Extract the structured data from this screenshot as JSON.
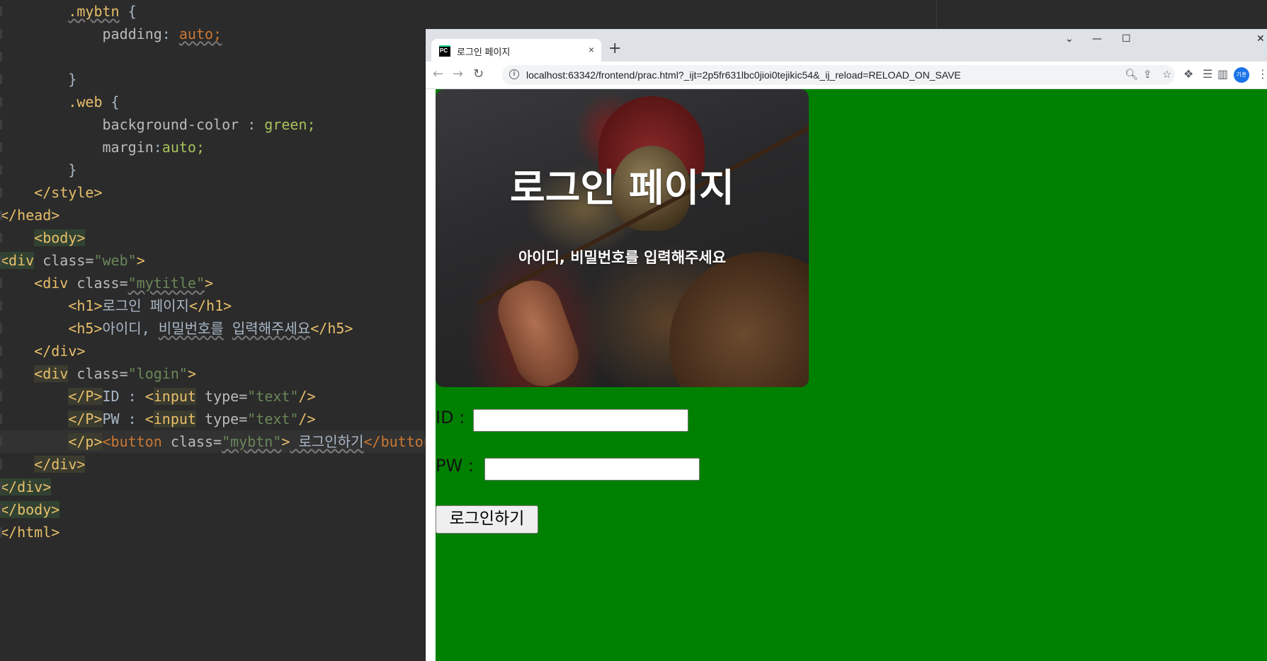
{
  "editor": {
    "lines": [
      {
        "tokens": [
          {
            "t": "        ",
            "c": "text"
          },
          {
            "t": ".mybtn",
            "c": "sel",
            "ul": true
          },
          {
            "t": " {",
            "c": "text"
          }
        ]
      },
      {
        "tokens": [
          {
            "t": "            ",
            "c": "text"
          },
          {
            "t": "padding",
            "c": "prop"
          },
          {
            "t": ": ",
            "c": "text"
          },
          {
            "t": "auto;",
            "c": "bad",
            "ul": true
          }
        ]
      },
      {
        "tokens": [
          {
            "t": "",
            "c": "text"
          }
        ]
      },
      {
        "tokens": [
          {
            "t": "        }",
            "c": "text"
          }
        ]
      },
      {
        "tokens": [
          {
            "t": "        ",
            "c": "text"
          },
          {
            "t": ".web",
            "c": "sel"
          },
          {
            "t": " {",
            "c": "text"
          }
        ]
      },
      {
        "tokens": [
          {
            "t": "            ",
            "c": "text"
          },
          {
            "t": "background-color",
            "c": "prop"
          },
          {
            "t": " : ",
            "c": "text"
          },
          {
            "t": "green;",
            "c": "val"
          }
        ]
      },
      {
        "tokens": [
          {
            "t": "            ",
            "c": "text"
          },
          {
            "t": "margin",
            "c": "prop"
          },
          {
            "t": ":",
            "c": "text"
          },
          {
            "t": "auto;",
            "c": "val"
          }
        ]
      },
      {
        "tokens": [
          {
            "t": "        }",
            "c": "text"
          }
        ]
      },
      {
        "tokens": [
          {
            "t": "    ",
            "c": "text"
          },
          {
            "t": "</style>",
            "c": "tag"
          }
        ]
      },
      {
        "tokens": [
          {
            "t": "</head>",
            "c": "tag"
          }
        ]
      },
      {
        "tokens": [
          {
            "t": "    ",
            "c": "text"
          },
          {
            "t": "<body>",
            "c": "tag",
            "hl": "tag"
          }
        ]
      },
      {
        "tokens": [
          {
            "t": "<div",
            "c": "tag",
            "hl": "tag"
          },
          {
            "t": " class=",
            "c": "attr"
          },
          {
            "t": "\"web\"",
            "c": "str"
          },
          {
            "t": ">",
            "c": "tag"
          }
        ]
      },
      {
        "tokens": [
          {
            "t": "    ",
            "c": "text"
          },
          {
            "t": "<div",
            "c": "tag"
          },
          {
            "t": " class=",
            "c": "attr"
          },
          {
            "t": "\"mytitle\"",
            "c": "str",
            "ul": true
          },
          {
            "t": ">",
            "c": "tag"
          }
        ]
      },
      {
        "tokens": [
          {
            "t": "        ",
            "c": "text"
          },
          {
            "t": "<h1>",
            "c": "tag"
          },
          {
            "t": "로그인 페이지",
            "c": "text"
          },
          {
            "t": "</h1>",
            "c": "tag"
          }
        ]
      },
      {
        "tokens": [
          {
            "t": "        ",
            "c": "text"
          },
          {
            "t": "<h5>",
            "c": "tag"
          },
          {
            "t": "아이디, ",
            "c": "text"
          },
          {
            "t": "비밀번호를",
            "c": "text",
            "ul": true
          },
          {
            "t": " ",
            "c": "text"
          },
          {
            "t": "입력해주세요",
            "c": "text",
            "ul": true
          },
          {
            "t": "</h5>",
            "c": "tag"
          }
        ]
      },
      {
        "tokens": [
          {
            "t": "    ",
            "c": "text"
          },
          {
            "t": "</div>",
            "c": "tag"
          }
        ]
      },
      {
        "tokens": [
          {
            "t": "    ",
            "c": "text"
          },
          {
            "t": "<div",
            "c": "tag",
            "hl": "box"
          },
          {
            "t": " class=",
            "c": "attr"
          },
          {
            "t": "\"login\"",
            "c": "str"
          },
          {
            "t": ">",
            "c": "tag"
          }
        ]
      },
      {
        "tokens": [
          {
            "t": "        ",
            "c": "text"
          },
          {
            "t": "</P>",
            "c": "tag",
            "hl": "box"
          },
          {
            "t": "ID : ",
            "c": "text"
          },
          {
            "t": "<",
            "c": "tag"
          },
          {
            "t": "input",
            "c": "tag",
            "hl": "box"
          },
          {
            "t": " type=",
            "c": "attr"
          },
          {
            "t": "\"text\"",
            "c": "str"
          },
          {
            "t": "/>",
            "c": "tag"
          }
        ]
      },
      {
        "tokens": [
          {
            "t": "        ",
            "c": "text"
          },
          {
            "t": "</P>",
            "c": "tag",
            "hl": "box"
          },
          {
            "t": "PW : ",
            "c": "text"
          },
          {
            "t": "<",
            "c": "tag"
          },
          {
            "t": "input",
            "c": "tag",
            "hl": "box"
          },
          {
            "t": " type=",
            "c": "attr"
          },
          {
            "t": "\"text\"",
            "c": "str"
          },
          {
            "t": "/>",
            "c": "tag"
          }
        ]
      },
      {
        "current": true,
        "tokens": [
          {
            "t": "        ",
            "c": "text"
          },
          {
            "t": "</p>",
            "c": "tag",
            "hl": "box"
          },
          {
            "t": "<button",
            "c": "bad"
          },
          {
            "t": " class=",
            "c": "attr"
          },
          {
            "t": "\"mybtn\"",
            "c": "str",
            "ul": true
          },
          {
            "t": ">",
            "c": "tag"
          },
          {
            "t": " 로그인하기",
            "c": "text",
            "ul": true
          },
          {
            "t": "</button>",
            "c": "bad"
          }
        ]
      },
      {
        "tokens": [
          {
            "t": "    ",
            "c": "text"
          },
          {
            "t": "</div>",
            "c": "tag",
            "hl": "box"
          }
        ]
      },
      {
        "tokens": [
          {
            "t": "</div>",
            "c": "tag",
            "hl": "tag"
          }
        ]
      },
      {
        "tokens": [
          {
            "t": "</body>",
            "c": "tag",
            "hl": "tag"
          }
        ]
      },
      {
        "tokens": [
          {
            "t": "</html>",
            "c": "tag"
          }
        ]
      }
    ]
  },
  "browser": {
    "tab": {
      "favicon_text": "PC",
      "title": "로그인 페이지",
      "close": "×"
    },
    "new_tab": "+",
    "window_controls": {
      "dropdown": "⌄",
      "minimize": "—",
      "maximize": "☐",
      "close": "✕"
    },
    "nav": {
      "back": "←",
      "forward": "→",
      "reload": "↻"
    },
    "omnibox": {
      "info": "i",
      "url": "localhost:63342/frontend/prac.html?_ijt=2p5fr631lbc0jioi0tejikic54&_ij_reload=RELOAD_ON_SAVE"
    },
    "profile_text": "기훈",
    "icons": [
      "zoom-icon",
      "share-icon",
      "star-icon",
      "extensions-icon",
      "reading-list-icon",
      "side-panel-icon",
      "more-icon"
    ]
  },
  "page": {
    "bg_color": "#008000",
    "title": "로그인 페이지",
    "subtitle": "아이디, 비밀번호를 입력해주세요",
    "id_label": "ID : ",
    "pw_label": "PW : ",
    "button_label": "로그인하기"
  }
}
